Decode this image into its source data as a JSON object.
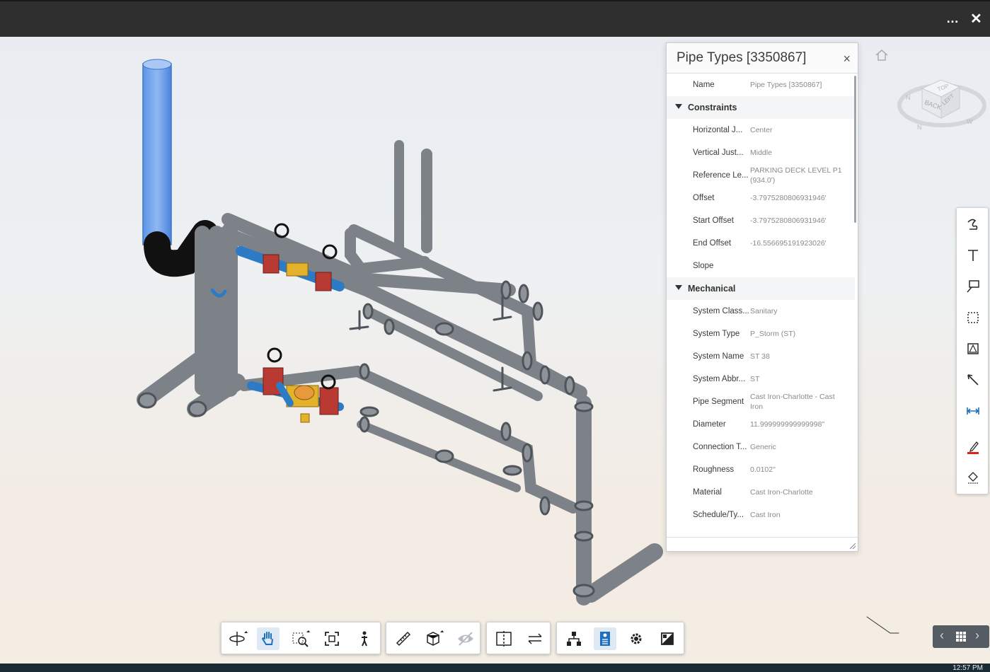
{
  "titlebar": {
    "more_label": "…",
    "close_label": "✕"
  },
  "panel": {
    "title": "Pipe Types [3350867]",
    "close_label": "×",
    "top_rows": [
      {
        "name": "Name",
        "value": "Pipe Types [3350867]"
      }
    ],
    "groups": [
      {
        "label": "Constraints",
        "rows": [
          {
            "name": "Horizontal J...",
            "value": "Center"
          },
          {
            "name": "Vertical Just...",
            "value": "Middle"
          },
          {
            "name": "Reference Le...",
            "value": "PARKING DECK LEVEL P1 (934.0')"
          },
          {
            "name": "Offset",
            "value": "-3.7975280806931946'"
          },
          {
            "name": "Start Offset",
            "value": "-3.7975280806931946'"
          },
          {
            "name": "End Offset",
            "value": "-16.556695191923026'"
          },
          {
            "name": "Slope",
            "value": ""
          }
        ]
      },
      {
        "label": "Mechanical",
        "rows": [
          {
            "name": "System Class...",
            "value": "Sanitary"
          },
          {
            "name": "System Type",
            "value": "P_Storm (ST)"
          },
          {
            "name": "System Name",
            "value": "ST 38"
          },
          {
            "name": "System Abbr...",
            "value": "ST"
          },
          {
            "name": "Pipe Segment",
            "value": "Cast Iron-Charlotte - Cast Iron"
          },
          {
            "name": "Diameter",
            "value": "11.999999999999998\""
          },
          {
            "name": "Connection T...",
            "value": "Generic"
          },
          {
            "name": "Roughness",
            "value": "0.0102\""
          },
          {
            "name": "Material",
            "value": "Cast Iron-Charlotte"
          },
          {
            "name": "Schedule/Ty...",
            "value": "Cast Iron"
          }
        ]
      }
    ]
  },
  "navcube": {
    "face_top": "TOP",
    "face_back": "BACK",
    "face_left": "LEFT",
    "compass": [
      "N",
      "W"
    ]
  },
  "right_toolbar": [
    "freehand-markup-icon",
    "text-markup-icon",
    "callout-markup-icon",
    "cloud-markup-icon",
    "polygon-markup-icon",
    "arrow-markup-icon",
    "dimension-markup-icon",
    "pen-color-icon",
    "fill-icon"
  ],
  "bottom_toolbar": {
    "groups": [
      [
        "orbit-icon",
        "pan-icon",
        "zoom-window-icon",
        "fit-to-view-icon",
        "first-person-icon"
      ],
      [
        "measure-icon",
        "section-box-icon",
        "explode-icon"
      ],
      [
        "split-view-icon",
        "sync-icon"
      ],
      [
        "model-browser-icon",
        "properties-icon",
        "settings-icon",
        "full-screen-icon"
      ]
    ],
    "active": [
      "pan-icon",
      "properties-icon"
    ]
  },
  "taskbar": {
    "time": "12:57 PM"
  },
  "colors": {
    "pipe": "#8c9298",
    "pipe_dark": "#5e6469",
    "valve_red": "#b83a32",
    "valve_yellow": "#e3b22a",
    "valve_blue": "#2d7bc4",
    "selected": "#4f8fe8"
  }
}
